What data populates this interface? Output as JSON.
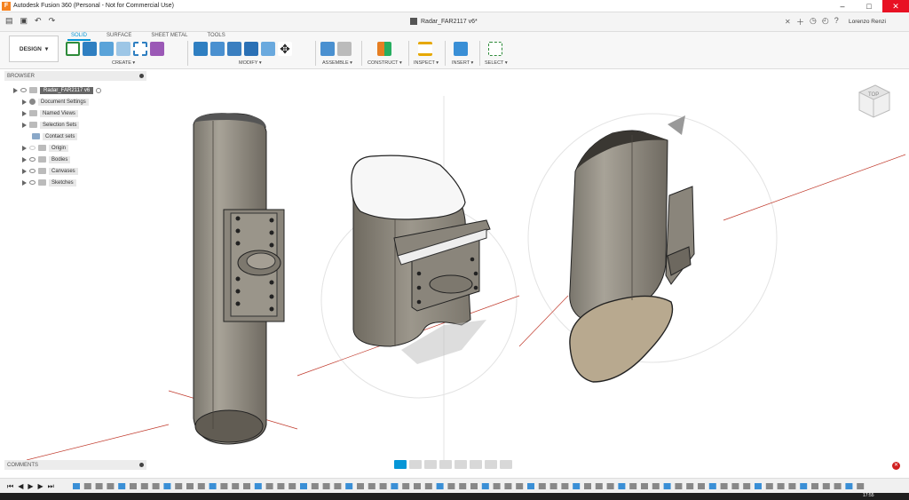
{
  "window": {
    "title": "Autodesk Fusion 360 (Personal - Not for Commercial Use)",
    "min": "–",
    "max": "□",
    "close": "✕"
  },
  "document": {
    "tab_title": "Radar_FAR2117 v6*",
    "tab_close": "✕",
    "user": "Lorenzo Renzi"
  },
  "toolbar": {
    "workspace": "DESIGN",
    "workspace_caret": "▾",
    "tabs": [
      "SOLID",
      "SURFACE",
      "SHEET METAL",
      "TOOLS"
    ],
    "active_tab": "SOLID",
    "groups": [
      "CREATE ▾",
      "MODIFY ▾",
      "ASSEMBLE ▾",
      "CONSTRUCT ▾",
      "INSPECT ▾",
      "INSERT ▾",
      "SELECT ▾"
    ]
  },
  "browser": {
    "title": "BROWSER",
    "root": "Radar_FAR2117 v6",
    "items": [
      "Document Settings",
      "Named Views",
      "Selection Sets",
      "Contact sets",
      "Origin",
      "Bodies",
      "Canvases",
      "Sketches"
    ]
  },
  "comments": {
    "title": "COMMENTS"
  },
  "viewcube": {
    "label": "TOP"
  },
  "statusbar": {
    "time": "17:55"
  },
  "colors": {
    "accent": "#0696d7",
    "body": "#8f8a80",
    "body_dark": "#6d685f",
    "cap": "#f4f4f4",
    "axis_red": "#c0392b"
  },
  "icons": {
    "qa": [
      "file-icon",
      "save-icon",
      "undo-icon",
      "redo-icon"
    ],
    "nav": [
      "orbit-icon",
      "look-at-icon",
      "pan-icon",
      "zoom-icon",
      "fit-icon",
      "display-icon",
      "grid-icon",
      "viewports-icon"
    ]
  }
}
